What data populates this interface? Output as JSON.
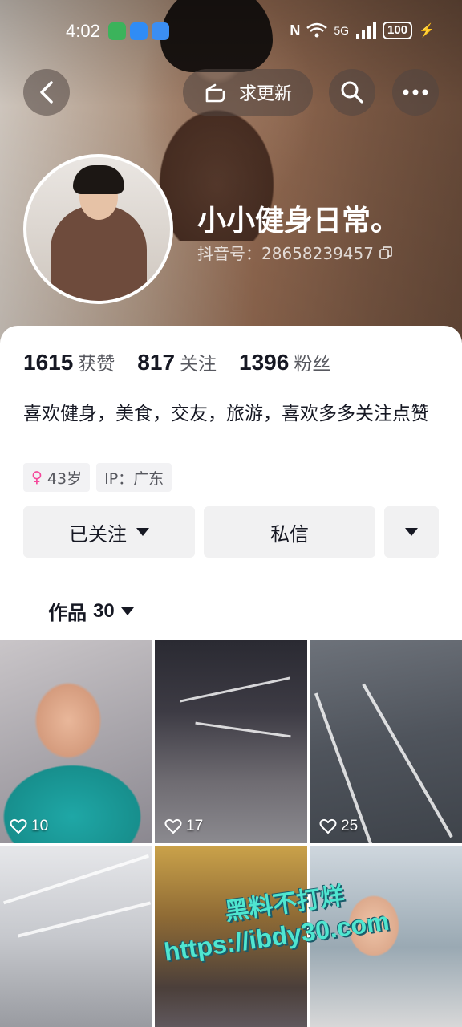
{
  "status_bar": {
    "time": "4:02",
    "network": "5G",
    "battery": "100"
  },
  "top_bar": {
    "update_label": "求更新"
  },
  "profile": {
    "nickname": "小小健身日常。",
    "douyin_id": "抖音号：28658239457"
  },
  "stats": [
    {
      "value": "1615",
      "label": "获赞"
    },
    {
      "value": "817",
      "label": "关注"
    },
    {
      "value": "1396",
      "label": "粉丝"
    }
  ],
  "bio": "喜欢健身，美食，交友，旅游，喜欢多多关注点赞",
  "tags": {
    "age": "43岁",
    "ip": "IP：广东"
  },
  "actions": {
    "follow_label": "已关注",
    "message_label": "私信"
  },
  "works_tab": {
    "label": "作品",
    "count": "30"
  },
  "videos": [
    {
      "likes": "10"
    },
    {
      "likes": "17"
    },
    {
      "likes": "25"
    },
    {
      "likes": ""
    },
    {
      "likes": ""
    },
    {
      "likes": ""
    }
  ],
  "watermark": {
    "line1": "黑料不打烊",
    "line2": "https://ibdy30.com"
  },
  "colors": {
    "accent_pink": "#f5479b",
    "watermark": "#4fe6d0"
  }
}
